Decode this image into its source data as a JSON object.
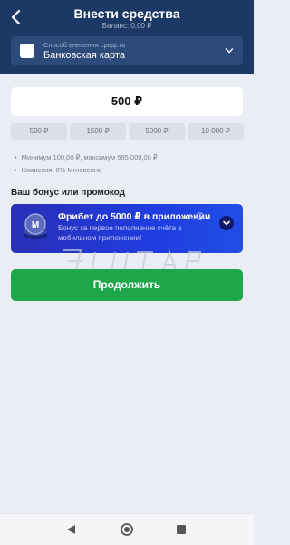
{
  "header": {
    "title": "Внести средства",
    "balance": "Баланс: 0,00 ₽"
  },
  "payment_method": {
    "label": "Способ внесения средств",
    "value": "Банковская карта"
  },
  "amount": {
    "value": "500 ₽"
  },
  "quick_amounts": [
    "500 ₽",
    "1500 ₽",
    "5000 ₽",
    "10 000 ₽"
  ],
  "info_lines": [
    "Минимум 100,00 ₽, максимум 595 000,00 ₽",
    "Комиссия: 0% Мгновенно"
  ],
  "bonus_section": {
    "title": "Ваш бонус или промокод",
    "card_title": "Фрибет до 5000 ₽ в приложении",
    "card_desc": "Бонус за первое пополнение счёта в мобильном приложении!"
  },
  "continue_label": "Продолжить",
  "colors": {
    "header": "#1c3865",
    "accent_green": "#1ea64a",
    "bonus_blue": "#1f3ce0"
  }
}
